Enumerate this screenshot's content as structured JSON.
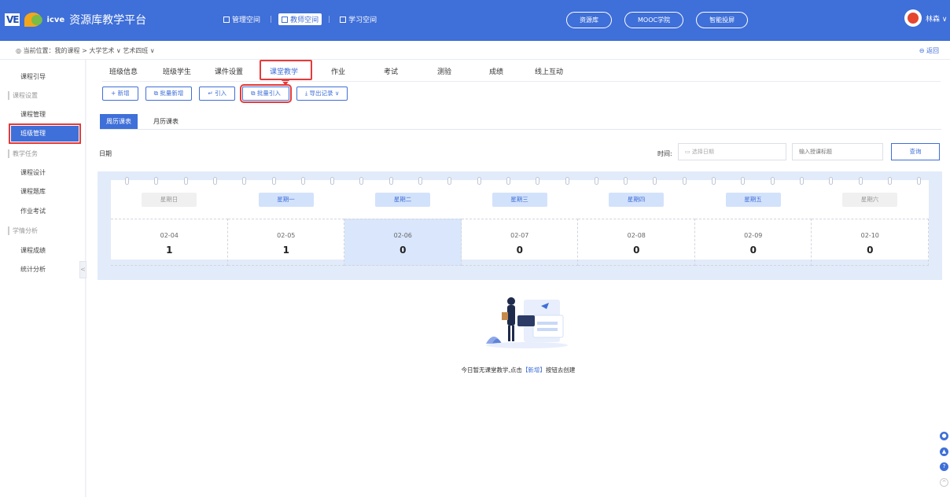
{
  "header": {
    "logo_ve": "VE",
    "logo_icve": "icve",
    "app_title": "资源库教学平台",
    "spaces": [
      {
        "label": "管理空间",
        "active": false
      },
      {
        "label": "教师空间",
        "active": true
      },
      {
        "label": "学习空间",
        "active": false
      }
    ],
    "separator": "|",
    "pills": [
      "资源库",
      "MOOC学院",
      "智能投屏"
    ],
    "user_name": "林森 ∨"
  },
  "breadcrumb": {
    "text": "当前位置：我的课程 > 大学艺术 ∨  艺术四班 ∨",
    "back": "返回"
  },
  "sidebar": {
    "items": [
      {
        "label": "课程引导",
        "type": "item"
      },
      {
        "label": "课程设置",
        "type": "group"
      },
      {
        "label": "课程管理",
        "type": "item"
      },
      {
        "label": "班级管理",
        "type": "active"
      },
      {
        "label": "教学任务",
        "type": "group"
      },
      {
        "label": "课程设计",
        "type": "item"
      },
      {
        "label": "课程题库",
        "type": "item"
      },
      {
        "label": "作业考试",
        "type": "item"
      },
      {
        "label": "学情分析",
        "type": "group"
      },
      {
        "label": "课程成绩",
        "type": "item"
      },
      {
        "label": "统计分析",
        "type": "item"
      }
    ],
    "collapse": "<"
  },
  "tabs": [
    "班级信息",
    "班级学生",
    "课件设置",
    "课堂教学",
    "作业",
    "考试",
    "测验",
    "成绩",
    "线上互动"
  ],
  "active_tab": "课堂教学",
  "toolbar": {
    "add": "+ 新增",
    "batch_add": "批量新增",
    "import": "引入",
    "batch_import": "批量引入",
    "export": "导出记录 ∨"
  },
  "subtabs": {
    "weekly": "周历课表",
    "monthly": "月历课表"
  },
  "filters": {
    "date_label": "日期",
    "time_label": "时间:",
    "date_placeholder": "选择日期",
    "title_placeholder": "输入授课标题",
    "query": "查询"
  },
  "calendar": {
    "days": [
      {
        "weekday": "星期日",
        "date": "02-04",
        "count": "1",
        "workday": false,
        "selected": false
      },
      {
        "weekday": "星期一",
        "date": "02-05",
        "count": "1",
        "workday": true,
        "selected": false
      },
      {
        "weekday": "星期二",
        "date": "02-06",
        "count": "0",
        "workday": true,
        "selected": true
      },
      {
        "weekday": "星期三",
        "date": "02-07",
        "count": "0",
        "workday": true,
        "selected": false
      },
      {
        "weekday": "星期四",
        "date": "02-08",
        "count": "0",
        "workday": true,
        "selected": false
      },
      {
        "weekday": "星期五",
        "date": "02-09",
        "count": "0",
        "workday": true,
        "selected": false
      },
      {
        "weekday": "星期六",
        "date": "02-10",
        "count": "0",
        "workday": false,
        "selected": false
      }
    ]
  },
  "empty": {
    "prefix": "今日暂无课堂教学,点击",
    "link": "【新增】",
    "suffix": "按钮去创建"
  },
  "colors": {
    "accent": "#3f6fd8",
    "highlight": "#e63a3a"
  }
}
